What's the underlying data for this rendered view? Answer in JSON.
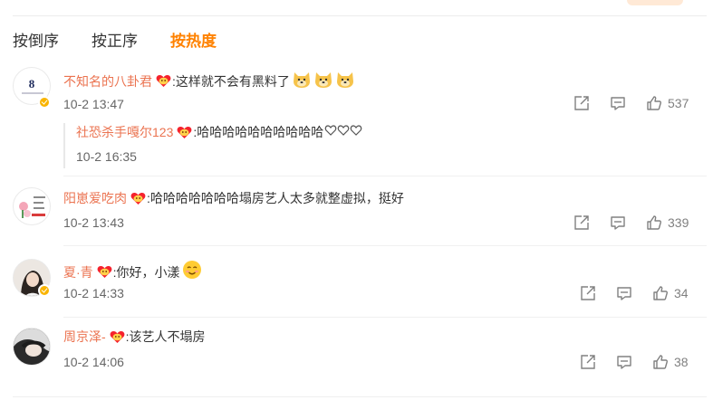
{
  "sort_tabs": [
    {
      "label": "按倒序",
      "active": false
    },
    {
      "label": "按正序",
      "active": false
    },
    {
      "label": "按热度",
      "active": true
    }
  ],
  "comments": [
    {
      "username": "不知名的八卦君",
      "text": ":这样就不会有黑料了",
      "avatar_text": "8",
      "time": "10-2 13:47",
      "likes": "537",
      "reply": {
        "username": "社恐杀手嘎尔123",
        "text": ":哈哈哈哈哈哈哈哈哈哈",
        "time": "10-2 16:35"
      }
    },
    {
      "username": "阳崽爱吃肉",
      "text": ":哈哈哈哈哈哈哈塌房艺人太多就整虚拟，挺好",
      "time": "10-2 13:43",
      "likes": "339"
    },
    {
      "username": "夏·青",
      "text": ":你好，小漾",
      "time": "10-2 14:33",
      "likes": "34"
    },
    {
      "username": "周京泽-",
      "text": ":该艺人不塌房",
      "time": "10-2 14:06",
      "likes": "38"
    }
  ],
  "colors": {
    "accent": "#ff8200",
    "username": "#eb7350",
    "badge": "#f9b400"
  }
}
